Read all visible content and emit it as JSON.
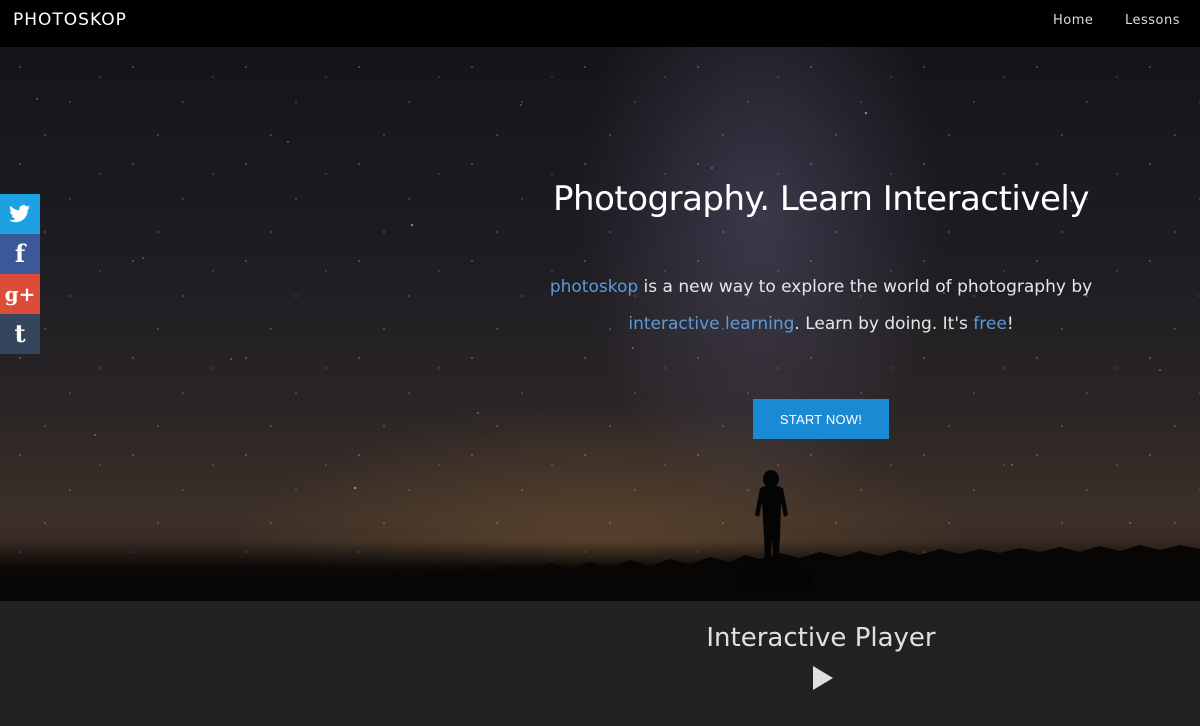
{
  "navbar": {
    "logo": "PHOTOSKOP",
    "links": [
      "Home",
      "Lessons"
    ]
  },
  "hero": {
    "title": "Photography. Learn Interactively",
    "desc_brand": "photoskop",
    "desc_part1": " is a new way to explore the world of photography by",
    "desc_link": "interactive learning",
    "desc_part2": ". Learn by doing. It's ",
    "desc_free": "free",
    "desc_end": "!",
    "cta_label": "START NOW!",
    "cta_color": "#1a8ad4",
    "highlight_color": "#5b9bdb"
  },
  "social": [
    {
      "name": "twitter",
      "glyph": "🐦",
      "color": "#1da1e2"
    },
    {
      "name": "facebook",
      "glyph": "f",
      "color": "#3b5998"
    },
    {
      "name": "google-plus",
      "glyph": "g+",
      "color": "#dd4b39"
    },
    {
      "name": "tumblr",
      "glyph": "t",
      "color": "#35465c"
    }
  ],
  "player": {
    "title": "Interactive Player",
    "icon": "play-icon"
  }
}
